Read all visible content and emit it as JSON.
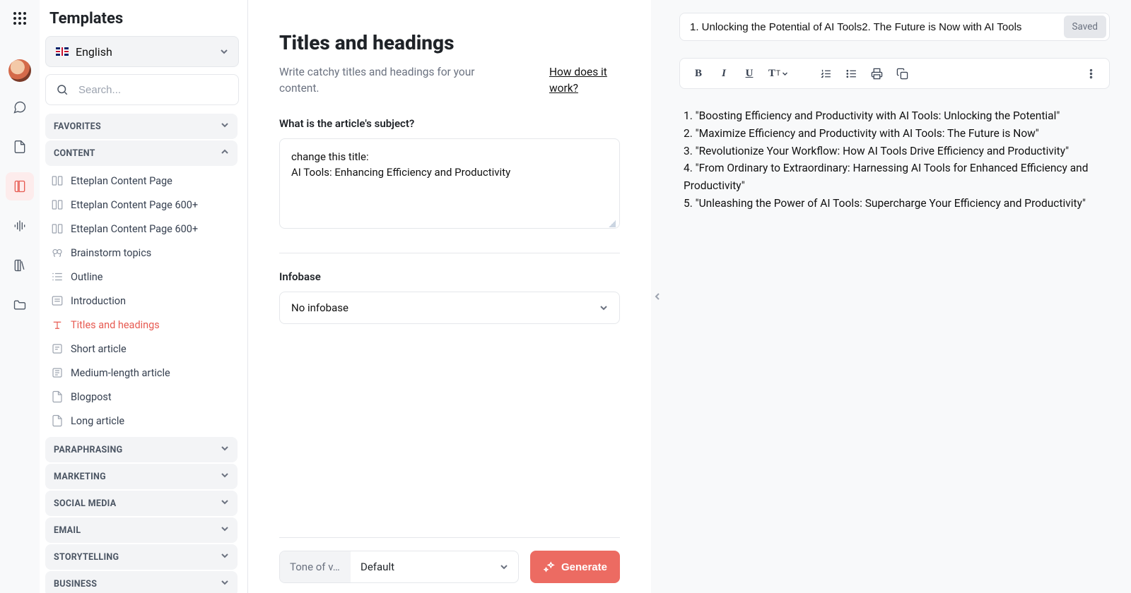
{
  "rail": {
    "icons": [
      "chat-icon",
      "document-icon",
      "templates-icon",
      "voice-icon",
      "library-icon",
      "folder-icon"
    ]
  },
  "sidebar": {
    "title": "Templates",
    "language": "English",
    "search_placeholder": "Search...",
    "sections": {
      "favorites": "Favorites",
      "content": "Content",
      "paraphrasing": "Paraphrasing",
      "marketing": "Marketing",
      "social_media": "Social Media",
      "email": "Email",
      "storytelling": "Storytelling",
      "business": "Business"
    },
    "content_items": [
      {
        "label": "Etteplan Content Page"
      },
      {
        "label": "Etteplan Content Page 600+"
      },
      {
        "label": "Etteplan Content Page 600+"
      },
      {
        "label": "Brainstorm topics"
      },
      {
        "label": "Outline"
      },
      {
        "label": "Introduction"
      },
      {
        "label": "Titles and headings",
        "active": true
      },
      {
        "label": "Short article"
      },
      {
        "label": "Medium-length article"
      },
      {
        "label": "Blogpost"
      },
      {
        "label": "Long article"
      }
    ]
  },
  "center": {
    "title": "Titles and headings",
    "subtitle": "Write catchy titles and headings for your content.",
    "how_link": "How does it work?",
    "subject_label": "What is the article's subject?",
    "subject_value": "change this title:\nAI Tools: Enhancing Efficiency and Productivity",
    "infobase_label": "Infobase",
    "infobase_value": "No infobase",
    "tone_label": "Tone of v…",
    "tone_value": "Default",
    "generate": "Generate"
  },
  "right": {
    "doc_title": "1. Unlocking the Potential of AI Tools2. The Future is Now with AI Tools",
    "saved": "Saved",
    "output_lines": [
      "1. \"Boosting Efficiency and Productivity with AI Tools: Unlocking the Potential\"",
      "2. \"Maximize Efficiency and Productivity with AI Tools: The Future is Now\"",
      "3. \"Revolutionize Your Workflow: How AI Tools Drive Efficiency and Productivity\"",
      "4. \"From Ordinary to Extraordinary: Harnessing AI Tools for Enhanced Efficiency and Productivity\"",
      "5. \"Unleashing the Power of AI Tools: Supercharge Your Efficiency and Productivity\""
    ]
  }
}
